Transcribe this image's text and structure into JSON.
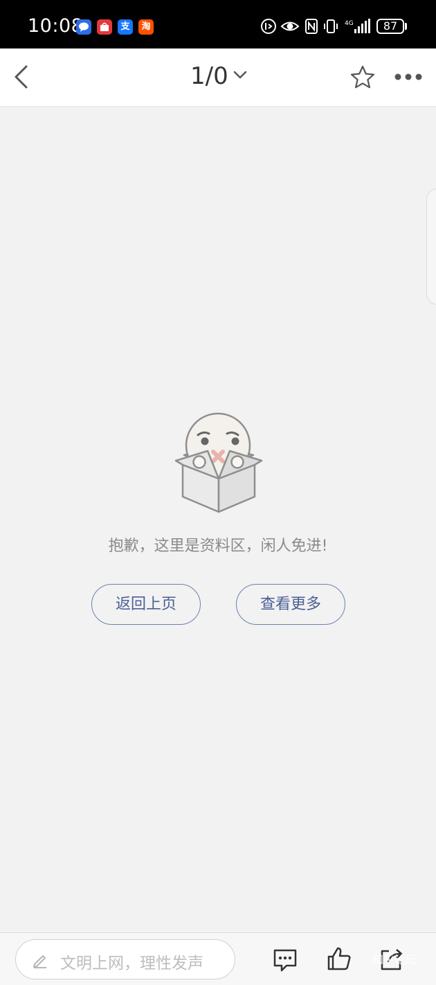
{
  "status_bar": {
    "time": "10:08",
    "apps": [
      {
        "icon": "messages-app-icon",
        "color": "#2b6ee6"
      },
      {
        "icon": "huawei-store-app-icon",
        "color": "#e4393c"
      },
      {
        "icon": "alipay-app-icon",
        "color": "#1677ff",
        "glyph": "支"
      },
      {
        "icon": "taobao-app-icon",
        "color": "#ff5000",
        "glyph": "淘"
      }
    ],
    "network": "4G",
    "battery": "87"
  },
  "header": {
    "page_counter": "1/0",
    "icons": [
      "back-icon",
      "chevron-down-icon",
      "star-icon",
      "more-icon"
    ]
  },
  "empty_state": {
    "message": "抱歉，这里是资料区，闲人免进!",
    "back_button": "返回上页",
    "more_button": "查看更多"
  },
  "bottom_bar": {
    "placeholder": "文明上网，理性发声",
    "icons": [
      "pencil-icon",
      "comment-icon",
      "like-icon",
      "share-icon"
    ],
    "watermark": "知乎论坛"
  },
  "colors": {
    "background": "#f2f2f2",
    "accent": "#4a5f95",
    "status_bar": "#000000"
  }
}
